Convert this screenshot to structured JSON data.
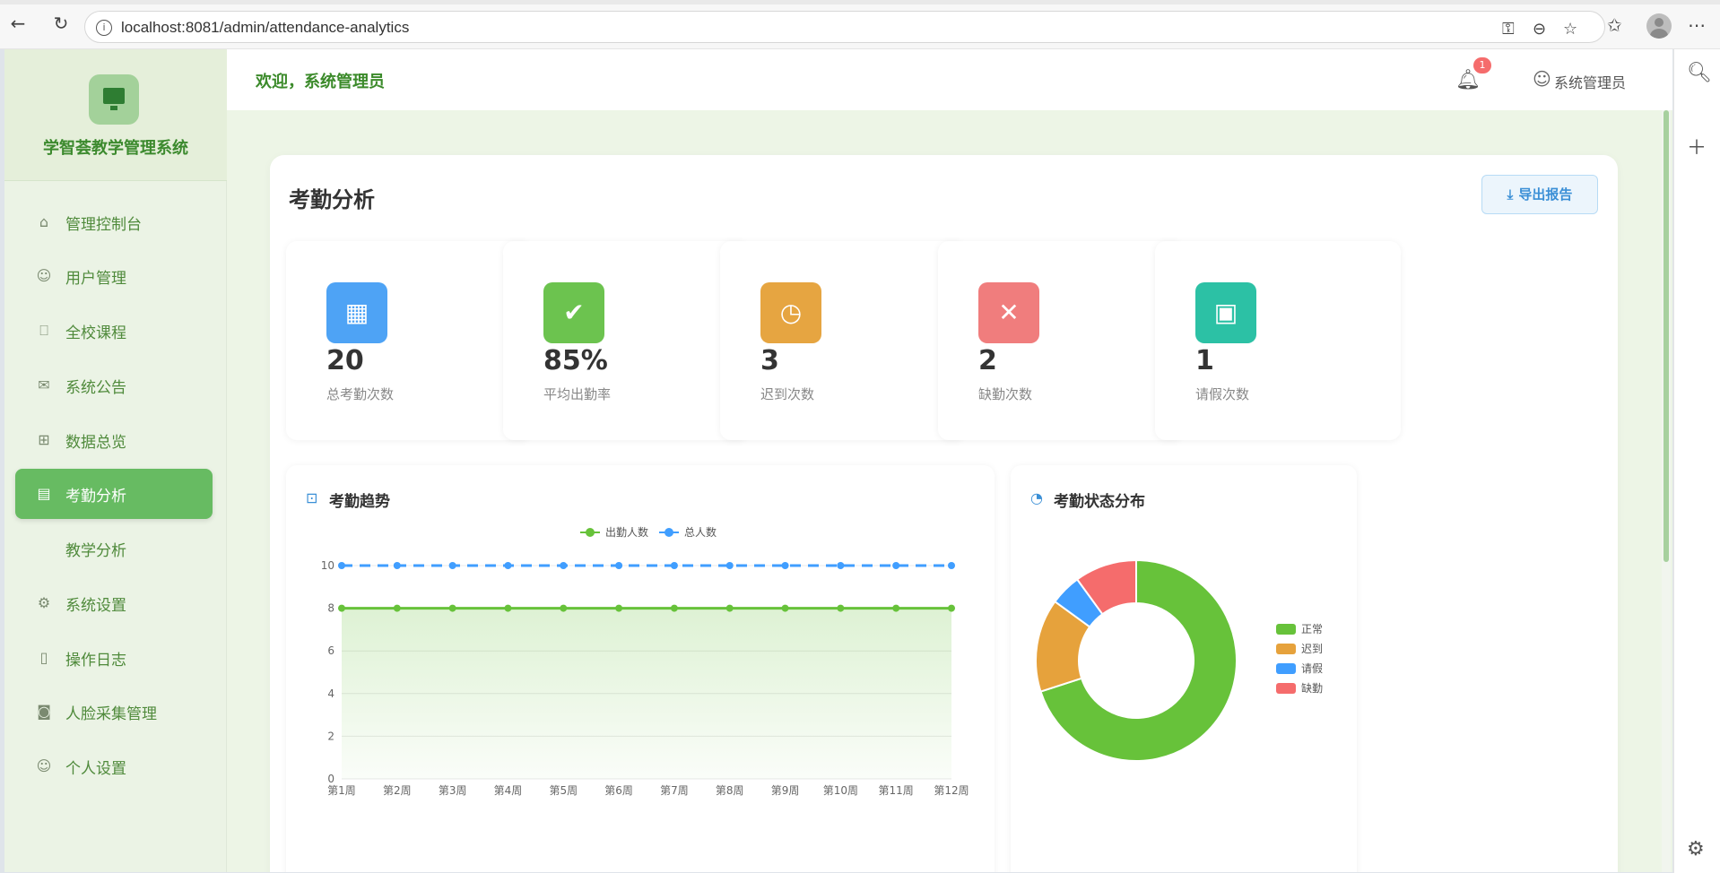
{
  "browser": {
    "url": "localhost:8081/admin/attendance-analytics"
  },
  "brand": {
    "name": "学智荟教学管理系统"
  },
  "sidebar": {
    "items": [
      {
        "label": "管理控制台",
        "icon": "home-icon"
      },
      {
        "label": "用户管理",
        "icon": "user-icon"
      },
      {
        "label": "全校课程",
        "icon": "bookmark-icon"
      },
      {
        "label": "系统公告",
        "icon": "mail-icon"
      },
      {
        "label": "数据总览",
        "icon": "presentation-icon"
      },
      {
        "label": "考勤分析",
        "icon": "notebook-icon",
        "active": true
      },
      {
        "label": "教学分析",
        "icon": "",
        "sub": true
      },
      {
        "label": "系统设置",
        "icon": "gear-icon"
      },
      {
        "label": "操作日志",
        "icon": "document-icon"
      },
      {
        "label": "人脸采集管理",
        "icon": "camera-icon"
      },
      {
        "label": "个人设置",
        "icon": "user-icon"
      }
    ]
  },
  "header": {
    "welcome": "欢迎，系统管理员",
    "notification_count": "1",
    "user_name": "系统管理员"
  },
  "page": {
    "title": "考勤分析",
    "export_label": "导出报告"
  },
  "stats": [
    {
      "value": "20",
      "label": "总考勤次数",
      "color": "#4ea3f5",
      "icon": "calendar-icon"
    },
    {
      "value": "85%",
      "label": "平均出勤率",
      "color": "#6cc34f",
      "icon": "check-circle-icon"
    },
    {
      "value": "3",
      "label": "迟到次数",
      "color": "#e6a541",
      "icon": "clock-icon"
    },
    {
      "value": "2",
      "label": "缺勤次数",
      "color": "#f07d7d",
      "icon": "close-circle-icon"
    },
    {
      "value": "1",
      "label": "请假次数",
      "color": "#2cc1a5",
      "icon": "file-check-icon"
    }
  ],
  "trend": {
    "title": "考勤趋势"
  },
  "distribution": {
    "title": "考勤状态分布"
  },
  "chart_data": [
    {
      "type": "line",
      "title": "考勤趋势",
      "x": [
        "第1周",
        "第2周",
        "第3周",
        "第4周",
        "第5周",
        "第6周",
        "第7周",
        "第8周",
        "第9周",
        "第10周",
        "第11周",
        "第12周"
      ],
      "series": [
        {
          "name": "出勤人数",
          "values": [
            8,
            8,
            8,
            8,
            8,
            8,
            8,
            8,
            8,
            8,
            8,
            8
          ],
          "color": "#67c23a",
          "area": true
        },
        {
          "name": "总人数",
          "values": [
            10,
            10,
            10,
            10,
            10,
            10,
            10,
            10,
            10,
            10,
            10,
            10
          ],
          "color": "#409eff",
          "dashed": true
        }
      ],
      "ylim": [
        0,
        10
      ],
      "yticks": [
        0,
        2,
        4,
        6,
        8,
        10
      ],
      "legend": "top-center",
      "grid": true
    },
    {
      "type": "pie",
      "title": "考勤状态分布",
      "donut": true,
      "slices": [
        {
          "name": "正常",
          "value": 70,
          "color": "#67c23a"
        },
        {
          "name": "迟到",
          "value": 15,
          "color": "#e6a23c"
        },
        {
          "name": "请假",
          "value": 5,
          "color": "#409eff"
        },
        {
          "name": "缺勤",
          "value": 10,
          "color": "#f56c6c"
        }
      ],
      "legend": "right"
    }
  ]
}
